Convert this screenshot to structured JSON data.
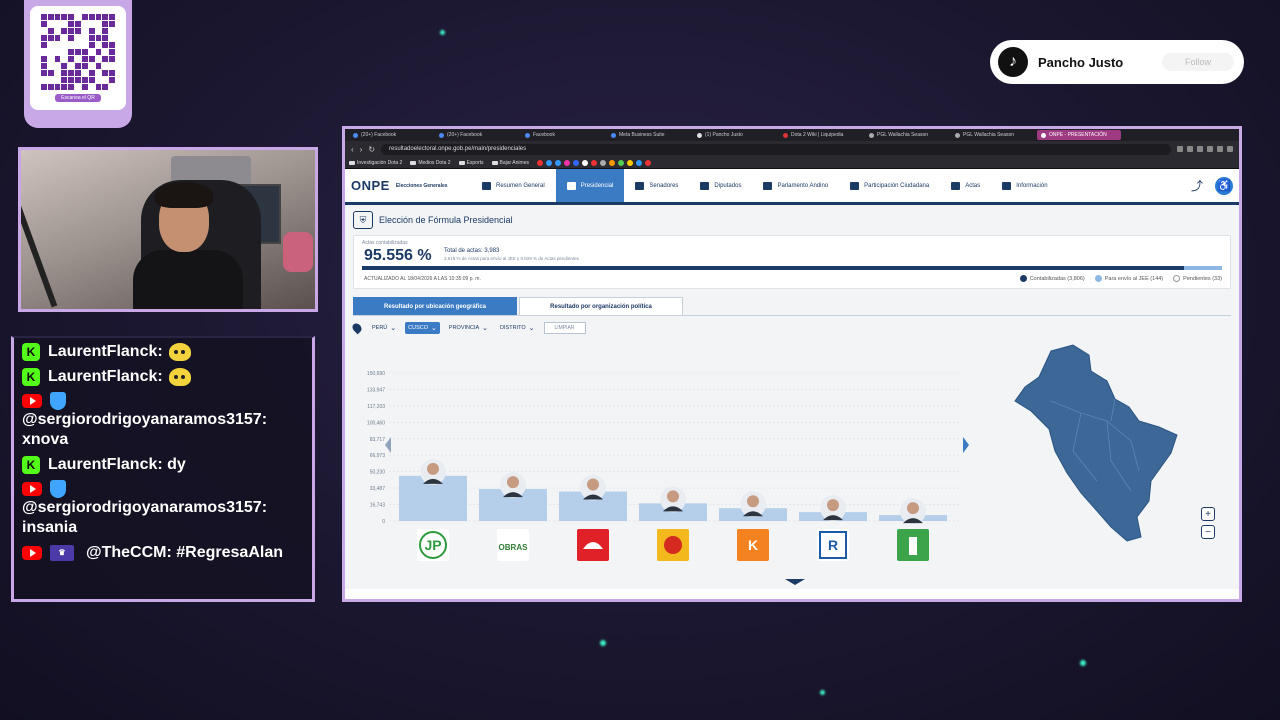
{
  "qr": {
    "caption": "Escanea el QR"
  },
  "tiktok": {
    "name": "Pancho Justo",
    "follow_label": "Follow"
  },
  "chat": {
    "messages": [
      {
        "platform": "kick",
        "user": "LaurentFlanck:",
        "text": ""
      },
      {
        "platform": "kick",
        "user": "LaurentFlanck:",
        "text": ""
      },
      {
        "platform": "youtube",
        "user": "@sergiorodrigoyanaramos3157:",
        "text": "xnova"
      },
      {
        "platform": "kick",
        "user": "LaurentFlanck:",
        "text": "dy"
      },
      {
        "platform": "youtube",
        "user": "@sergiorodrigoyanaramos3157:",
        "text": "insania"
      },
      {
        "platform": "youtube",
        "user": "@TheCCM:",
        "text": "#RegresaAlan"
      }
    ]
  },
  "browser": {
    "tabs": [
      "(20+) Facebook",
      "(20+) Facebook",
      "Facebook",
      "Meta Business Suite",
      "(1) Pancho Justo",
      "Dota 2 Wiki | Liquipedia",
      "PGL Wallachia Season",
      "PGL Wallachia Season",
      "ONPE - PRESENTACIÓN"
    ],
    "url": "resultadoelectoral.onpe.gob.pe/main/presidenciales",
    "bookmarks": [
      "Investigación Dota 2",
      "Medios Dota 2",
      "Esports",
      "Bajar Animes"
    ]
  },
  "onpe": {
    "logo_text": "ONPE",
    "logo_sub": "Elecciones Generales",
    "nav": [
      "Resumen General",
      "Presidencial",
      "Senadores",
      "Diputados",
      "Parlamento Andino",
      "Participación Ciudadana",
      "Actas",
      "Información"
    ],
    "active_nav": 1,
    "title": "Elección de Fórmula Presidencial",
    "actas_label": "Actas contabilizadas",
    "percent": "95.556 %",
    "progress": 0.95556,
    "total_actas": "Total de actas: 3,983",
    "sub_actas": "3.615 % de Actas para envío al JEE y 0.829 % de Actas pendientes",
    "updated": "ACTUALIZADO AL 18/04/2026 A LAS 10:35:09 p. m.",
    "legend": [
      {
        "label": "Contabilizadas (3,806)",
        "color": "#1b3a64"
      },
      {
        "label": "Para envío al JEE (144)",
        "color": "#8fb7e3"
      },
      {
        "label": "Pendientes (33)",
        "color": "#ffffff"
      }
    ],
    "result_tabs": [
      "Resultado por ubicación geográfica",
      "Resultado por organización política"
    ],
    "filters": {
      "country": "PERÚ",
      "department": "CUSCO",
      "province": "PROVINCIA",
      "district": "DISTRITO",
      "clear": "LIMPIAR"
    }
  },
  "chart_data": {
    "type": "bar",
    "y_ticks": [
      "150,690",
      "133,947",
      "117,203",
      "100,460",
      "83,717",
      "66,973",
      "50,230",
      "33,487",
      "16,743",
      "0"
    ],
    "ylim": [
      0,
      150690
    ],
    "values": [
      46000,
      32500,
      30000,
      18000,
      13000,
      9000,
      6000
    ],
    "bar_color": "#a9c7e6",
    "party_logos": [
      {
        "name": "JP",
        "bg": "#ffffff",
        "fg": "#2e9b3e"
      },
      {
        "name": "OBRAS",
        "bg": "#ffffff",
        "fg": "#2e7d32"
      },
      {
        "name": "casco",
        "bg": "#e02127",
        "fg": "#ffffff"
      },
      {
        "name": "sol",
        "bg": "#f2b81c",
        "fg": "#d42a1f"
      },
      {
        "name": "K",
        "bg": "#f58220",
        "fg": "#ffffff"
      },
      {
        "name": "R",
        "bg": "#ffffff",
        "fg": "#1d5aa7"
      },
      {
        "name": "faro",
        "bg": "#3ca54b",
        "fg": "#ffffff"
      }
    ]
  }
}
